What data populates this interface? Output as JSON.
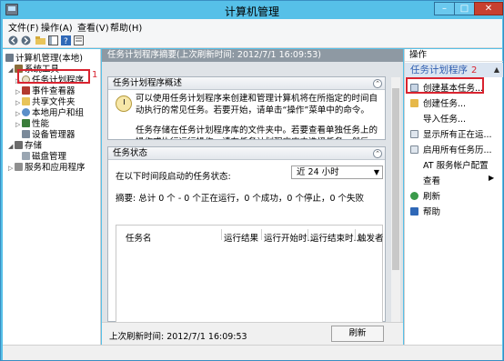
{
  "window": {
    "title": "计算机管理",
    "min_label": "–",
    "max_label": "□",
    "close_label": "✕"
  },
  "menu": [
    "文件(F)",
    "操作(A)",
    "查看(V)",
    "帮助(H)"
  ],
  "toolbar": {
    "icons": [
      "back-arrow-icon",
      "forward-arrow-icon",
      "folder-up-icon",
      "show-tree-icon",
      "help-icon",
      "properties-icon"
    ]
  },
  "tree": {
    "root": "计算机管理(本地)",
    "system_tools": "系统工具",
    "task_scheduler": "任务计划程序",
    "event_viewer": "事件查看器",
    "shared_folders": "共享文件夹",
    "local_users": "本地用户和组",
    "performance": "性能",
    "device_manager": "设备管理器",
    "storage": "存储",
    "disk_mgmt": "磁盘管理",
    "services": "服务和应用程序"
  },
  "annotations": {
    "one": "1",
    "two": "2"
  },
  "middle": {
    "header": "任务计划程序摘要(上次刷新时间: 2012/7/1 16:09:53)",
    "overview_title": "任务计划程序概述",
    "overview_text1": "可以使用任务计划程序来创建和管理计算机将在所指定的时间自动执行的常见任务。若要开始，请单击“操作”菜单中的命令。",
    "overview_text2": "任务存储在任务计划程序库的文件夹中。若要查看单独任务上的操作或执行运行操作，请在任务计划程序库中选择任务，然后在“操作”",
    "status_title": "任务状态",
    "status_label": "在以下时间段启动的任务状态:",
    "range_value": "近 24 小时",
    "summary": "摘要: 总计 0 个 - 0 个正在运行，0 个成功，0 个停止，0 个失败",
    "columns": [
      "任务名",
      "运行结果",
      "运行开始时...",
      "运行结束时...",
      "触发者"
    ],
    "last_refresh": "上次刷新时间: 2012/7/1 16:09:53",
    "refresh_button": "刷新"
  },
  "actions": {
    "title": "操作",
    "group": "任务计划程序",
    "items": [
      "创建基本任务...",
      "创建任务...",
      "导入任务...",
      "显示所有正在运...",
      "启用所有任务历...",
      "AT 服务帐户配置",
      "查看",
      "刷新",
      "帮助"
    ]
  },
  "colors": {
    "title_bar": "#56c0e8",
    "highlight": "#d9232f",
    "group_bg": "#dbe5f1"
  }
}
